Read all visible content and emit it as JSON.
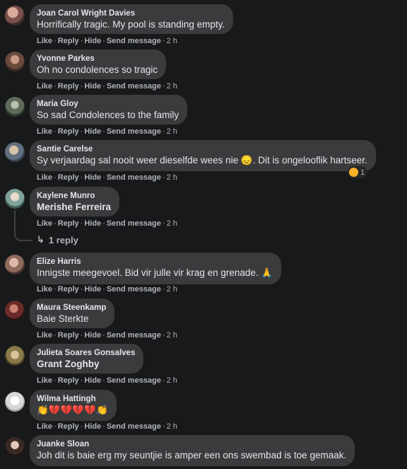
{
  "actions": {
    "like": "Like",
    "reply": "Reply",
    "hide": "Hide",
    "send": "Send message",
    "time": "2 h"
  },
  "comments": [
    {
      "author": "Joan Carol Wright Davies",
      "text": "Horrifically tragic. My pool is standing empty."
    },
    {
      "author": "Yvonne Parkes",
      "text": "Oh no condolences so tragic"
    },
    {
      "author": "Maria Gloy",
      "text": "So sad Condolences to the family"
    },
    {
      "author": "Santie Carelse",
      "text": "Sy verjaardag sal nooit weer dieselfde wees nie 😞. Dit is ongelooflik hartseer.",
      "reaction_count": "1"
    },
    {
      "author": "Kaylene Munro",
      "text": "Merishe Ferreira",
      "reply_label": "1 reply"
    },
    {
      "author": "Elize Harris",
      "text": "Innigste meegevoel. Bid vir julle vir krag en grenade. 🙏"
    },
    {
      "author": "Maura Steenkamp",
      "text": "Baie Sterkte"
    },
    {
      "author": "Julieta Soares Gonsalves",
      "text": "Grant Zoghby"
    },
    {
      "author": "Wilma Hattingh",
      "text": "👏💔💔💔💔👏"
    },
    {
      "author": "Juanke Sloan",
      "text": "Joh dit is baie erg my seuntjie is amper een ons swembad is toe gemaak."
    }
  ],
  "colors": {
    "background": "#18191a",
    "bubble": "#3a3b3c",
    "muted": "#b0b3b8",
    "text": "#e4e6eb"
  }
}
